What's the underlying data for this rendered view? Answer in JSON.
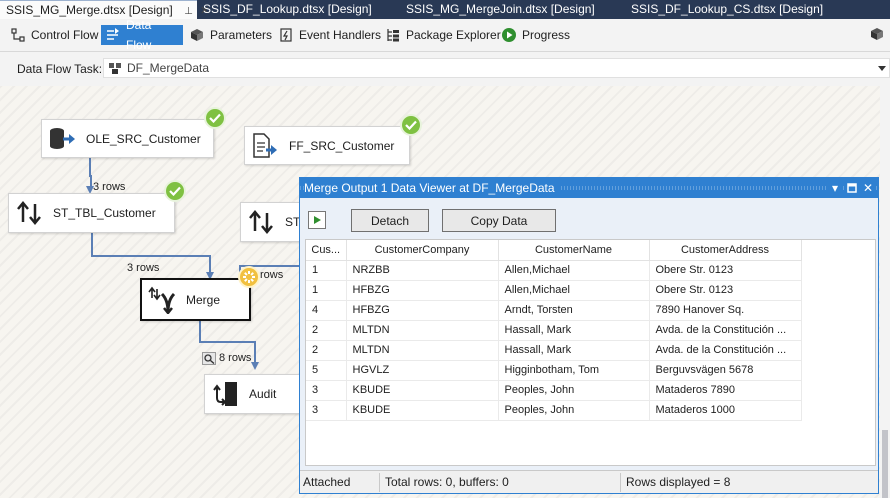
{
  "tabs": [
    {
      "label": "SSIS_MG_Merge.dtsx [Design]",
      "active": true
    },
    {
      "label": "SSIS_DF_Lookup.dtsx [Design]",
      "active": false
    },
    {
      "label": "SSIS_MG_MergeJoin.dtsx [Design]",
      "active": false
    },
    {
      "label": "SSIS_DF_Lookup_CS.dtsx [Design]",
      "active": false
    }
  ],
  "toolbar": {
    "control_flow": "Control Flow",
    "data_flow": "Data Flow",
    "parameters": "Parameters",
    "event_handlers": "Event Handlers",
    "package_explorer": "Package Explorer",
    "progress": "Progress"
  },
  "data_flow_task": {
    "label": "Data Flow Task:",
    "value": "DF_MergeData"
  },
  "components": {
    "ole_src": "OLE_SRC_Customer",
    "ff_src": "FF_SRC_Customer",
    "st_tbl": "ST_TBL_Customer",
    "st_2": "ST",
    "merge": "Merge",
    "audit": "Audit"
  },
  "paths": {
    "ole_to_st": "3 rows",
    "st_to_merge": "3 rows",
    "st2_to_merge": "rows",
    "merge_to_audit": "8 rows"
  },
  "viewer": {
    "title": "Merge Output 1 Data Viewer at DF_MergeData",
    "detach_label": "Detach",
    "copy_label": "Copy Data",
    "columns": [
      "Cus...",
      "CustomerCompany",
      "CustomerName",
      "CustomerAddress"
    ],
    "rows": [
      [
        "1",
        "NRZBB",
        "Allen,Michael",
        "Obere Str. 0123"
      ],
      [
        "1",
        "HFBZG",
        "Allen,Michael",
        "Obere Str. 0123"
      ],
      [
        "4",
        "HFBZG",
        "Arndt, Torsten",
        "7890 Hanover Sq."
      ],
      [
        "2",
        "MLTDN",
        "Hassall, Mark",
        "Avda. de la Constitución ..."
      ],
      [
        "2",
        "MLTDN",
        "Hassall, Mark",
        "Avda. de la Constitución ..."
      ],
      [
        "5",
        "HGVLZ",
        "Higginbotham, Tom",
        "Berguvsvägen  5678"
      ],
      [
        "3",
        "KBUDE",
        "Peoples, John",
        "Mataderos  7890"
      ],
      [
        "3",
        "KBUDE",
        "Peoples, John",
        "Mataderos  1000"
      ]
    ],
    "status_attached": "Attached",
    "status_total": "Total rows: 0, buffers: 0",
    "status_displayed": "Rows displayed = 8"
  }
}
